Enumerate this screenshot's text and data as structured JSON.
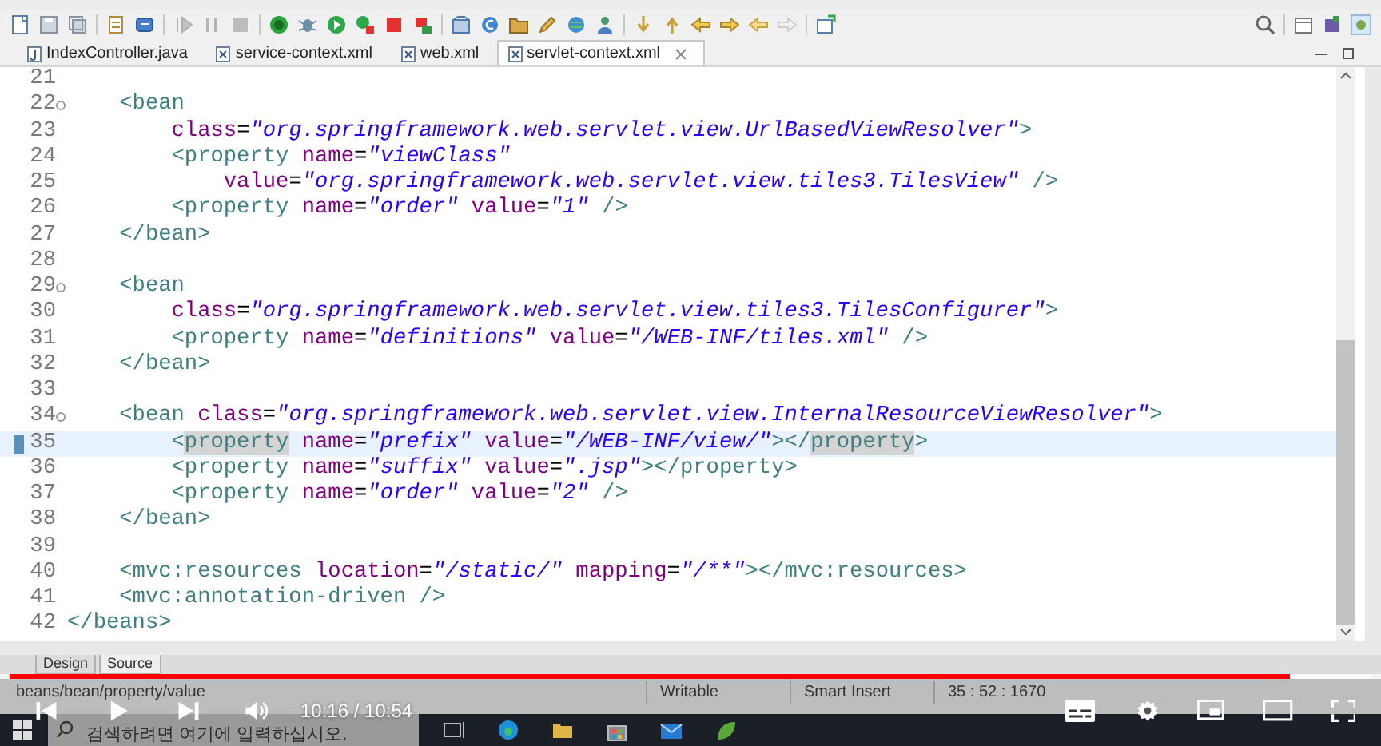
{
  "editor_tabs": [
    {
      "label": "IndexController.java",
      "kind": "java",
      "selected": false
    },
    {
      "label": "service-context.xml",
      "kind": "xml",
      "selected": false
    },
    {
      "label": "web.xml",
      "kind": "xml",
      "selected": false
    },
    {
      "label": "servlet-context.xml",
      "kind": "xml",
      "selected": true
    }
  ],
  "code_lines": [
    {
      "number": "21",
      "foldable": false,
      "current": false
    },
    {
      "number": "22",
      "foldable": true,
      "current": false,
      "segments": [
        {
          "kind": "tag",
          "text": "    <bean"
        }
      ]
    },
    {
      "number": "23",
      "foldable": false,
      "current": false,
      "segments": [
        {
          "kind": "attr",
          "text": "        class"
        },
        {
          "kind": "plain",
          "text": "="
        },
        {
          "kind": "value",
          "text": "\"org.springframework.web.servlet.view.UrlBasedViewResolver\""
        },
        {
          "kind": "tag",
          "text": ">"
        }
      ]
    },
    {
      "number": "24",
      "foldable": false,
      "current": false,
      "segments": [
        {
          "kind": "tag",
          "text": "        <property"
        },
        {
          "kind": "attr",
          "text": " name"
        },
        {
          "kind": "plain",
          "text": "="
        },
        {
          "kind": "value",
          "text": "\"viewClass\""
        }
      ]
    },
    {
      "number": "25",
      "foldable": false,
      "current": false,
      "segments": [
        {
          "kind": "attr",
          "text": "            value"
        },
        {
          "kind": "plain",
          "text": "="
        },
        {
          "kind": "value",
          "text": "\"org.springframework.web.servlet.view.tiles3.TilesView\""
        },
        {
          "kind": "tag",
          "text": " />"
        }
      ]
    },
    {
      "number": "26",
      "foldable": false,
      "current": false,
      "segments": [
        {
          "kind": "tag",
          "text": "        <property"
        },
        {
          "kind": "attr",
          "text": " name"
        },
        {
          "kind": "plain",
          "text": "="
        },
        {
          "kind": "value",
          "text": "\"order\""
        },
        {
          "kind": "attr",
          "text": " value"
        },
        {
          "kind": "plain",
          "text": "="
        },
        {
          "kind": "value",
          "text": "\"1\""
        },
        {
          "kind": "tag",
          "text": " />"
        }
      ]
    },
    {
      "number": "27",
      "foldable": false,
      "current": false,
      "segments": [
        {
          "kind": "tag",
          "text": "    </bean>"
        }
      ]
    },
    {
      "number": "28",
      "foldable": false,
      "current": false
    },
    {
      "number": "29",
      "foldable": true,
      "current": false,
      "segments": [
        {
          "kind": "tag",
          "text": "    <bean"
        }
      ]
    },
    {
      "number": "30",
      "foldable": false,
      "current": false,
      "segments": [
        {
          "kind": "attr",
          "text": "        class"
        },
        {
          "kind": "plain",
          "text": "="
        },
        {
          "kind": "value",
          "text": "\"org.springframework.web.servlet.view.tiles3.TilesConfigurer\""
        },
        {
          "kind": "tag",
          "text": ">"
        }
      ]
    },
    {
      "number": "31",
      "foldable": false,
      "current": false,
      "segments": [
        {
          "kind": "tag",
          "text": "        <property"
        },
        {
          "kind": "attr",
          "text": " name"
        },
        {
          "kind": "plain",
          "text": "="
        },
        {
          "kind": "value",
          "text": "\"definitions\""
        },
        {
          "kind": "attr",
          "text": " value"
        },
        {
          "kind": "plain",
          "text": "="
        },
        {
          "kind": "value",
          "text": "\"/WEB-INF/tiles.xml\""
        },
        {
          "kind": "tag",
          "text": " />"
        }
      ]
    },
    {
      "number": "32",
      "foldable": false,
      "current": false,
      "segments": [
        {
          "kind": "tag",
          "text": "    </bean>"
        }
      ]
    },
    {
      "number": "33",
      "foldable": false,
      "current": false
    },
    {
      "number": "34",
      "foldable": true,
      "current": false,
      "segments": [
        {
          "kind": "tag",
          "text": "    <bean"
        },
        {
          "kind": "attr",
          "text": " class"
        },
        {
          "kind": "plain",
          "text": "="
        },
        {
          "kind": "value",
          "text": "\"org.springframework.web.servlet.view.InternalResourceViewResolver\""
        },
        {
          "kind": "tag",
          "text": ">"
        }
      ]
    },
    {
      "number": "35",
      "foldable": false,
      "current": true,
      "segments": [
        {
          "kind": "tag",
          "text": "        <"
        },
        {
          "kind": "marked",
          "text": "property"
        },
        {
          "kind": "attr",
          "text": " name"
        },
        {
          "kind": "plain",
          "text": "="
        },
        {
          "kind": "value",
          "text": "\"prefix\""
        },
        {
          "kind": "attr",
          "text": " value"
        },
        {
          "kind": "plain",
          "text": "="
        },
        {
          "kind": "value",
          "text": "\"/WEB-INF/view/\""
        },
        {
          "kind": "tag",
          "text": "></"
        },
        {
          "kind": "marked",
          "text": "property"
        },
        {
          "kind": "tag",
          "text": ">"
        }
      ]
    },
    {
      "number": "36",
      "foldable": false,
      "current": false,
      "segments": [
        {
          "kind": "tag",
          "text": "        <property"
        },
        {
          "kind": "attr",
          "text": " name"
        },
        {
          "kind": "plain",
          "text": "="
        },
        {
          "kind": "value",
          "text": "\"suffix\""
        },
        {
          "kind": "attr",
          "text": " value"
        },
        {
          "kind": "plain",
          "text": "="
        },
        {
          "kind": "value",
          "text": "\".jsp\""
        },
        {
          "kind": "tag",
          "text": "></property>"
        }
      ]
    },
    {
      "number": "37",
      "foldable": false,
      "current": false,
      "segments": [
        {
          "kind": "tag",
          "text": "        <property"
        },
        {
          "kind": "attr",
          "text": " name"
        },
        {
          "kind": "plain",
          "text": "="
        },
        {
          "kind": "value",
          "text": "\"order\""
        },
        {
          "kind": "attr",
          "text": " value"
        },
        {
          "kind": "plain",
          "text": "="
        },
        {
          "kind": "value",
          "text": "\"2\""
        },
        {
          "kind": "tag",
          "text": " />"
        }
      ]
    },
    {
      "number": "38",
      "foldable": false,
      "current": false,
      "segments": [
        {
          "kind": "tag",
          "text": "    </bean>"
        }
      ]
    },
    {
      "number": "39",
      "foldable": false,
      "current": false
    },
    {
      "number": "40",
      "foldable": false,
      "current": false,
      "segments": [
        {
          "kind": "tag",
          "text": "    <mvc:resources"
        },
        {
          "kind": "attr",
          "text": " location"
        },
        {
          "kind": "plain",
          "text": "="
        },
        {
          "kind": "value",
          "text": "\"/static/\""
        },
        {
          "kind": "attr",
          "text": " mapping"
        },
        {
          "kind": "plain",
          "text": "="
        },
        {
          "kind": "value",
          "text": "\"/**\""
        },
        {
          "kind": "tag",
          "text": "></mvc:resources>"
        }
      ]
    },
    {
      "number": "41",
      "foldable": false,
      "current": false,
      "segments": [
        {
          "kind": "tag",
          "text": "    <mvc:annotation-driven />"
        }
      ]
    },
    {
      "number": "42",
      "foldable": false,
      "current": false,
      "segments": [
        {
          "kind": "tag",
          "text": "</beans>"
        }
      ]
    }
  ],
  "view_tabs": [
    {
      "label": "Design",
      "selected": false
    },
    {
      "label": "Source",
      "selected": true
    }
  ],
  "status_bar": {
    "path": "beans/bean/property/value",
    "mode": "Writable",
    "insert_mode": "Smart Insert",
    "position": "35 : 52 : 1670"
  },
  "video_player": {
    "time": "10:16 / 10:54",
    "progress": {
      "level": 0.94
    }
  },
  "taskbar": {
    "search": {
      "placeholder": "검색하려면 여기에 입력하십시오."
    }
  }
}
